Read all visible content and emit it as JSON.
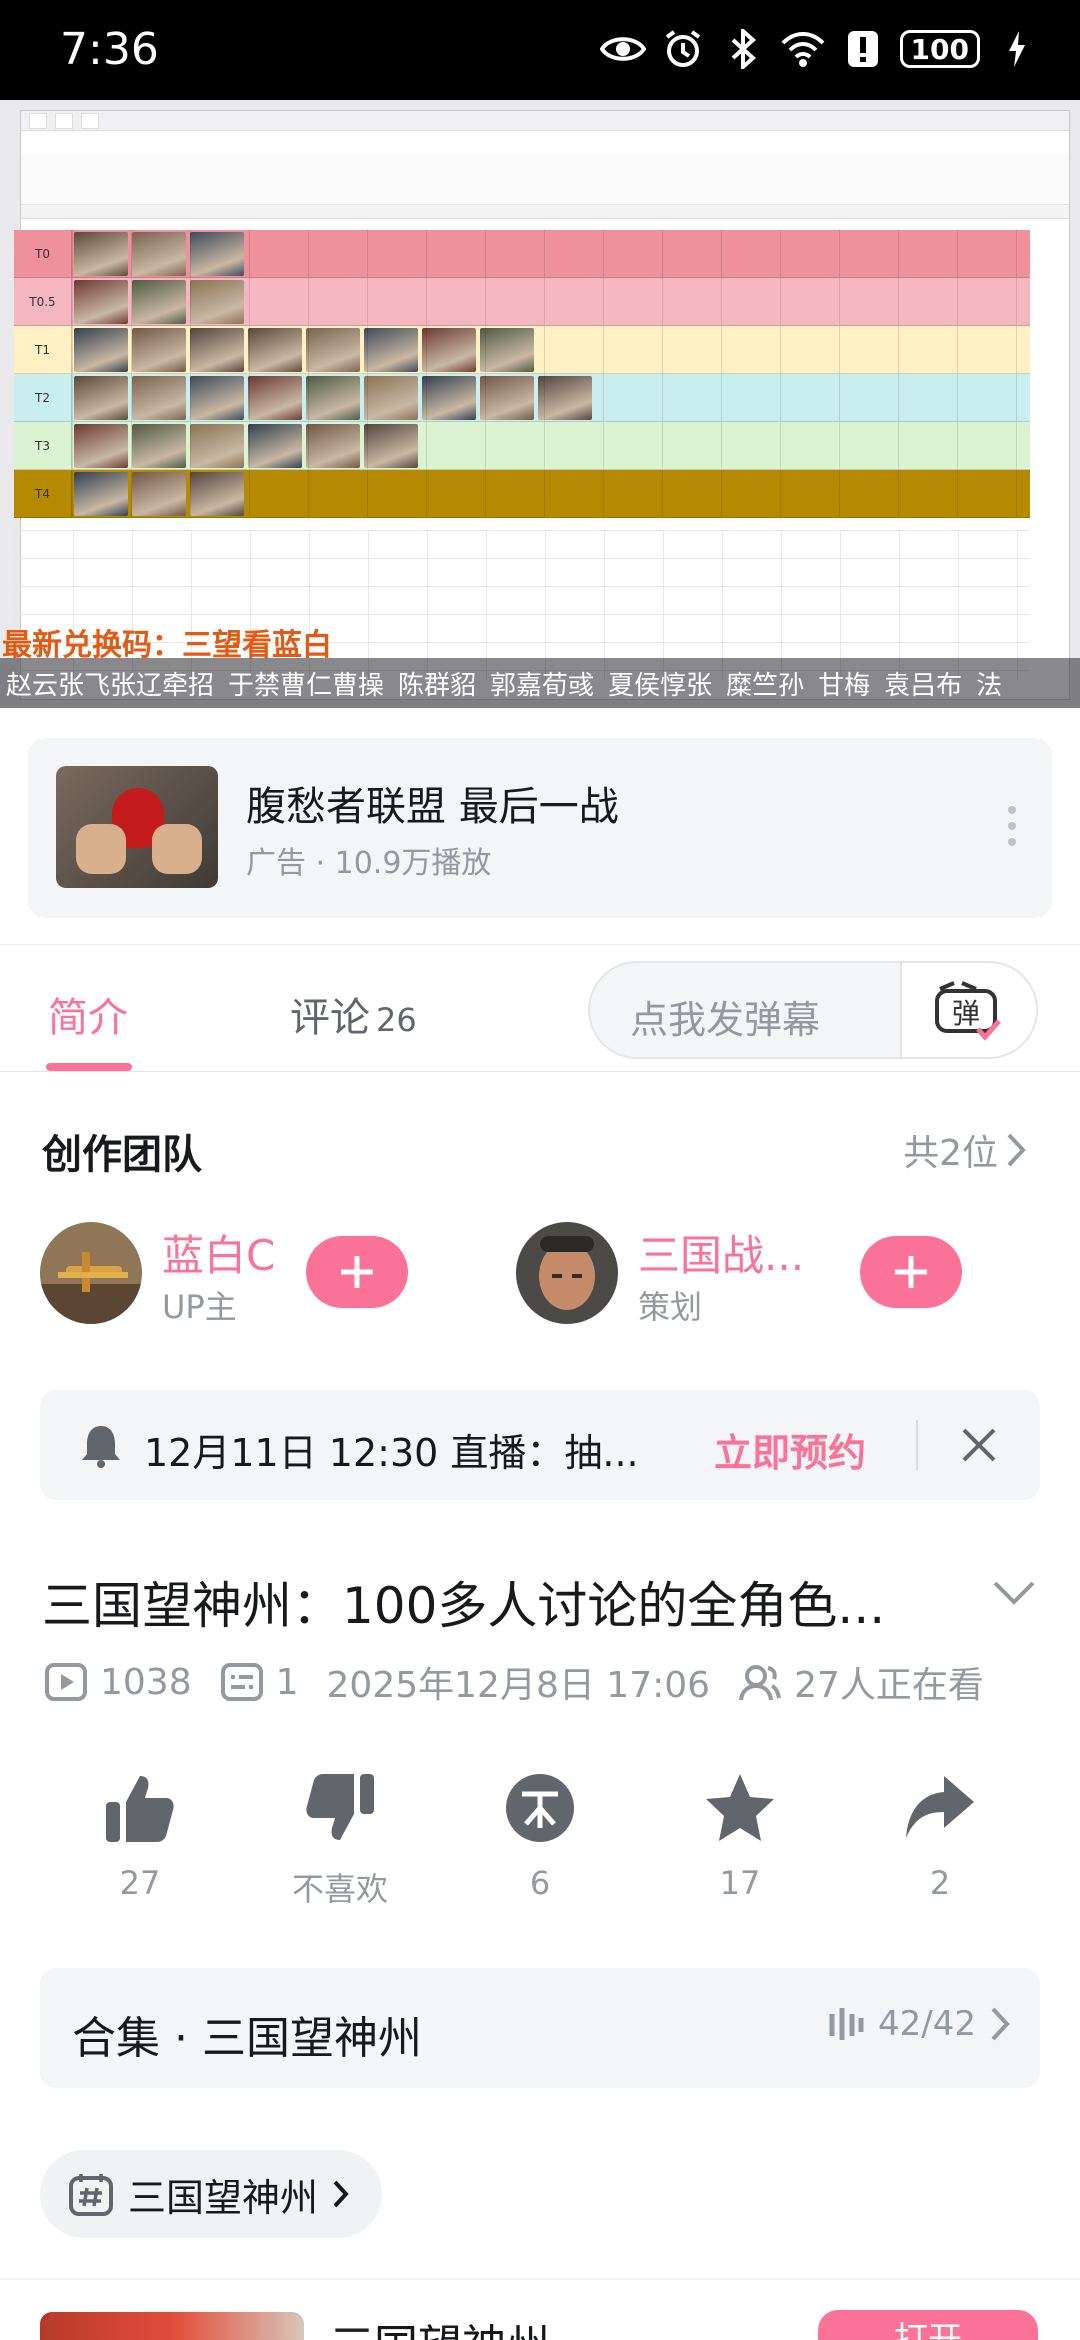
{
  "status_bar": {
    "time": "7:36",
    "battery": "100",
    "icons": [
      "eye-icon",
      "alarm-icon",
      "bluetooth-icon",
      "wifi-icon",
      "alert-icon",
      "battery-icon",
      "charging-icon"
    ]
  },
  "video": {
    "tier_labels": [
      "T0",
      "T0.5",
      "T1",
      "T2",
      "T3",
      "T4"
    ],
    "tier_colors": [
      "#ef919b",
      "#f4b7c0",
      "#fff1c4",
      "#c9eef0",
      "#dcf3d2",
      "#b58a00"
    ],
    "promo_text": "最新兑换码：三望看蓝白",
    "danmaku": [
      "赵云张飞张辽牵招",
      "于禁曹仁曹操",
      "陈群貂",
      "郭嘉荀彧",
      "夏侯惇张",
      "糜竺孙",
      "甘梅",
      "袁吕布",
      "法"
    ]
  },
  "ad": {
    "title": "腹愁者联盟 最后一战",
    "meta": "广告 · 10.9万播放"
  },
  "tabs": {
    "intro": "简介",
    "comments": "评论",
    "comments_count": "26",
    "danmaku_placeholder": "点我发弹幕",
    "danmaku_btn": "弹"
  },
  "team": {
    "title": "创作团队",
    "count": "共2位",
    "members": [
      {
        "name": "蓝白C",
        "role": "UP主"
      },
      {
        "name": "三国战...",
        "role": "策划"
      }
    ]
  },
  "live": {
    "text": "12月11日 12:30 直播：抽...",
    "reserve": "立即预约"
  },
  "video_info": {
    "title": "三国望神州：100多人讨论的全角色...",
    "plays": "1038",
    "danmaku_count": "1",
    "date": "2025年12月8日 17:06",
    "watching": "27人正在看"
  },
  "actions": {
    "like": "27",
    "dislike": "不喜欢",
    "coin": "6",
    "favorite": "17",
    "share": "2"
  },
  "collection": {
    "title": "合集 · 三国望神州",
    "progress": "42/42"
  },
  "tag": {
    "label": "三国望神州"
  },
  "recommend": {
    "title": "三国望神州",
    "button": "打开"
  },
  "colors": {
    "accent": "#fb7299",
    "muted": "#9499a0",
    "text": "#18191c"
  }
}
